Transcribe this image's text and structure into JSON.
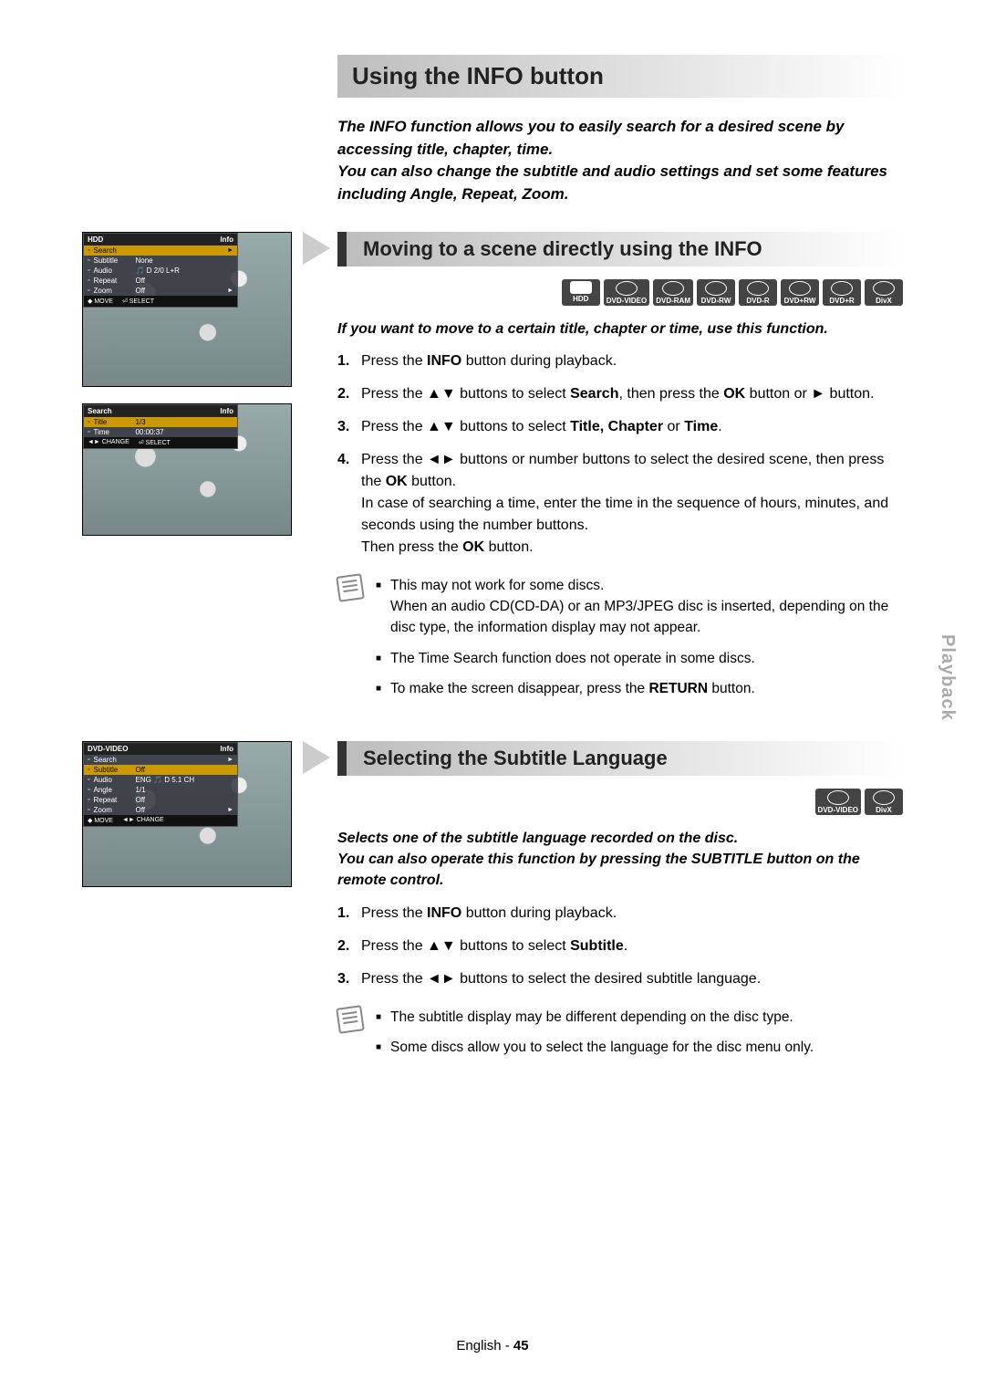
{
  "sideTab": "Playback",
  "title": "Using the INFO button",
  "intro": "The INFO function allows you to easily search for a desired scene by accessing title, chapter, time.\nYou can also change the subtitle and audio settings and set some features including Angle, Repeat, Zoom.",
  "section1": {
    "heading": "Moving to a scene directly using the INFO",
    "badges": [
      "HDD",
      "DVD-VIDEO",
      "DVD-RAM",
      "DVD-RW",
      "DVD-R",
      "DVD+RW",
      "DVD+R",
      "DivX"
    ],
    "desc": "If you want to move to a certain title, chapter or time, use this function.",
    "steps": [
      {
        "n": "1.",
        "t": "Press the <b>INFO</b> button during playback."
      },
      {
        "n": "2.",
        "t": "Press the ▲▼ buttons to select <b>Search</b>, then press the <b>OK</b> button or ► button."
      },
      {
        "n": "3.",
        "t": "Press the ▲▼ buttons to select <b>Title, Chapter</b> or <b>Time</b>."
      },
      {
        "n": "4.",
        "t": "Press the ◄► buttons or number buttons to select the desired scene, then press the <b>OK</b> button.<br>In case of searching a time, enter the time in the sequence of hours, minutes, and seconds using the number buttons.<br>Then press the <b>OK</b> button."
      }
    ],
    "notes": [
      "This may not work for some discs.\nWhen an audio CD(CD-DA) or an MP3/JPEG disc is inserted, depending on the disc type, the information display may not appear.",
      "The Time Search function does not operate in some discs.",
      "To make the screen disappear, press the <b>RETURN</b> button."
    ],
    "osd1": {
      "title": "HDD",
      "corner": "Info",
      "rows": [
        {
          "k": "Search",
          "v": "",
          "hl": true,
          "arr": "►"
        },
        {
          "k": "Subtitle",
          "v": "None"
        },
        {
          "k": "Audio",
          "v": "🎵 D 2/0 L+R"
        },
        {
          "k": "Repeat",
          "v": "Off"
        },
        {
          "k": "Zoom",
          "v": "Off",
          "arr": "►"
        }
      ],
      "foot": [
        "◆ MOVE",
        "⏎ SELECT"
      ]
    },
    "osd2": {
      "title": "Search",
      "corner": "Info",
      "rows": [
        {
          "k": "Title",
          "v": "1/3",
          "hl": true
        },
        {
          "k": "Time",
          "v": "00:00:37"
        }
      ],
      "foot": [
        "◄► CHANGE",
        "⏎ SELECT"
      ]
    }
  },
  "section2": {
    "heading": "Selecting the Subtitle Language",
    "badges": [
      "DVD-VIDEO",
      "DivX"
    ],
    "desc": "Selects one of the subtitle language recorded on the disc.\nYou can also operate this function by pressing the SUBTITLE button on the remote control.",
    "steps": [
      {
        "n": "1.",
        "t": "Press the <b>INFO</b> button during playback."
      },
      {
        "n": "2.",
        "t": "Press the ▲▼ buttons to select <b>Subtitle</b>."
      },
      {
        "n": "3.",
        "t": "Press the ◄► buttons to select the desired subtitle language."
      }
    ],
    "notes": [
      "The subtitle display may be different depending on the disc type.",
      "Some discs allow you to select the language for the disc menu only."
    ],
    "osd": {
      "title": "DVD-VIDEO",
      "corner": "Info",
      "rows": [
        {
          "k": "Search",
          "v": "",
          "arr": "►"
        },
        {
          "k": "Subtitle",
          "v": "Off",
          "hl": true
        },
        {
          "k": "Audio",
          "v": "ENG 🎵 D 5.1 CH"
        },
        {
          "k": "Angle",
          "v": "1/1"
        },
        {
          "k": "Repeat",
          "v": "Off"
        },
        {
          "k": "Zoom",
          "v": "Off",
          "arr": "►"
        }
      ],
      "foot": [
        "◆ MOVE",
        "◄► CHANGE"
      ]
    }
  },
  "footer": {
    "lang": "English",
    "sep": " - ",
    "page": "45"
  }
}
